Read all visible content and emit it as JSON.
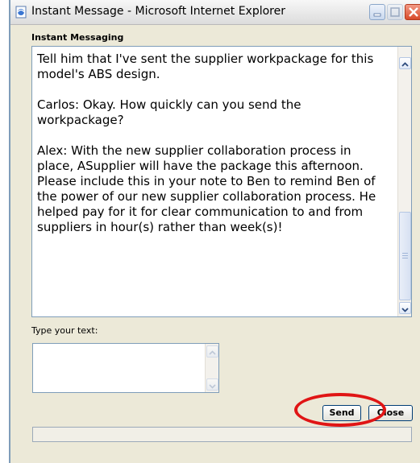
{
  "window": {
    "title": "Instant Message - Microsoft Internet Explorer"
  },
  "chat": {
    "section_label": "Instant Messaging",
    "messages": [
      "Tell him that I've sent the supplier workpackage for this model's ABS design.",
      "Carlos: Okay. How quickly can you send the workpackage?",
      "Alex: With the new supplier collaboration process in place, ASupplier will have the package this afternoon.  Please include this in your note to Ben to remind Ben of the power of our new supplier collaboration process. He helped pay for it for clear communication to and from suppliers in hour(s) rather than week(s)!"
    ]
  },
  "compose": {
    "label": "Type your text:",
    "value": ""
  },
  "buttons": {
    "send": "Send",
    "close": "Close"
  },
  "icons": {
    "title": "ie-page-icon",
    "minimize": "minimize-icon",
    "maximize": "maximize-icon",
    "close": "close-x-icon",
    "scroll_up": "chevron-up-icon",
    "scroll_down": "chevron-down-icon"
  },
  "colors": {
    "highlight": "#e01515",
    "close_button": "#d84a2a",
    "border": "#7f9db9"
  }
}
